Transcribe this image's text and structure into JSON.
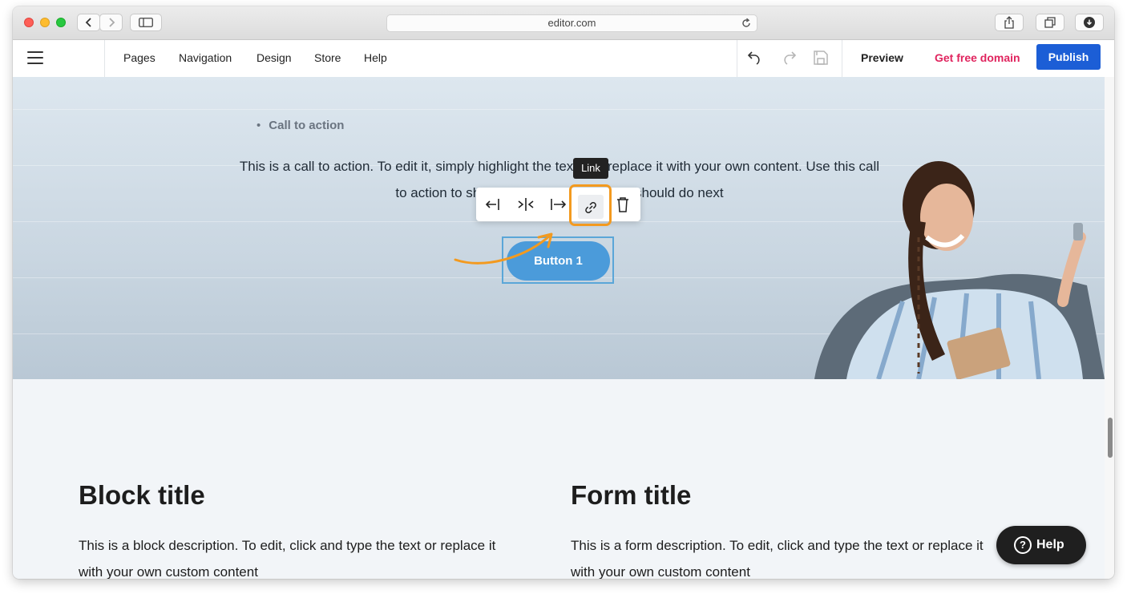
{
  "browser": {
    "url": "editor.com"
  },
  "toolbar": {
    "nav": [
      "Pages",
      "Navigation",
      "Design",
      "Store",
      "Help"
    ],
    "preview_label": "Preview",
    "domain_label": "Get free domain",
    "publish_label": "Publish"
  },
  "hero": {
    "bullet": "Call to action",
    "text": "This is a call to action. To edit it, simply highlight the text and replace it with your own content. Use this call to action to show site visitors what they should do next",
    "button_label": "Button 1",
    "tooltip": "Link"
  },
  "lower": {
    "block_title": "Block title",
    "block_desc": "This is a block description. To edit, click and type the text or replace it with your own custom content",
    "form_title": "Form title",
    "form_desc": "This is a form description. To edit, click and type the text or replace it with your own custom content"
  },
  "help": {
    "label": "Help",
    "glyph": "?"
  },
  "colors": {
    "publish": "#1c5ed6",
    "domain": "#e0245e",
    "highlight": "#f39a1f",
    "button": "#4b9bda"
  }
}
